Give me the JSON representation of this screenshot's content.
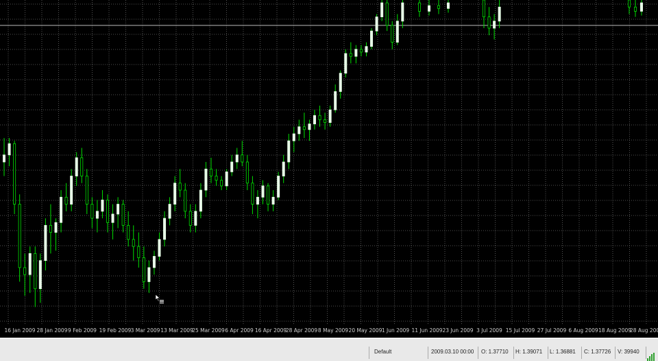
{
  "chart_data": {
    "type": "candlestick",
    "symbol_timeframe": "",
    "x_ticks": [
      "16 Jan 2009",
      "28 Jan 2009",
      "9 Feb 2009",
      "19 Feb 2009",
      "3 Mar 2009",
      "13 Mar 2009",
      "25 Mar 2009",
      "6 Apr 2009",
      "16 Apr 2009",
      "28 Apr 2009",
      "8 May 2009",
      "20 May 2009",
      "1 Jun 2009",
      "11 Jun 2009",
      "23 Jun 2009",
      "3 Jul 2009",
      "15 Jul 2009",
      "27 Jul 2009",
      "6 Aug 2009",
      "18 Aug 2009",
      "28 Aug 2009"
    ],
    "y_range": [
      1.24,
      1.47
    ],
    "horizontal_line": 1.452,
    "grid": true,
    "bull_color": "#e8ffe8",
    "bear_color": "#00e000",
    "wick_color": "#00e000",
    "background": "#000000",
    "grid_color": "#6a6a6a",
    "candles": [
      [
        1.355,
        1.372,
        1.345,
        1.36
      ],
      [
        1.36,
        1.372,
        1.352,
        1.368
      ],
      [
        1.368,
        1.37,
        1.318,
        1.325
      ],
      [
        1.325,
        1.332,
        1.27,
        1.28
      ],
      [
        1.28,
        1.29,
        1.26,
        1.275
      ],
      [
        1.275,
        1.295,
        1.262,
        1.29
      ],
      [
        1.29,
        1.295,
        1.252,
        1.265
      ],
      [
        1.265,
        1.29,
        1.255,
        1.285
      ],
      [
        1.285,
        1.315,
        1.278,
        1.31
      ],
      [
        1.31,
        1.325,
        1.29,
        1.305
      ],
      [
        1.305,
        1.315,
        1.292,
        1.312
      ],
      [
        1.312,
        1.335,
        1.305,
        1.33
      ],
      [
        1.33,
        1.34,
        1.32,
        1.325
      ],
      [
        1.325,
        1.35,
        1.32,
        1.345
      ],
      [
        1.345,
        1.362,
        1.338,
        1.358
      ],
      [
        1.358,
        1.365,
        1.34,
        1.345
      ],
      [
        1.345,
        1.35,
        1.318,
        1.325
      ],
      [
        1.325,
        1.33,
        1.308,
        1.315
      ],
      [
        1.315,
        1.328,
        1.305,
        1.32
      ],
      [
        1.32,
        1.335,
        1.315,
        1.328
      ],
      [
        1.328,
        1.332,
        1.305,
        1.312
      ],
      [
        1.312,
        1.325,
        1.3,
        1.318
      ],
      [
        1.318,
        1.33,
        1.308,
        1.325
      ],
      [
        1.325,
        1.328,
        1.305,
        1.31
      ],
      [
        1.31,
        1.32,
        1.295,
        1.3
      ],
      [
        1.3,
        1.31,
        1.285,
        1.295
      ],
      [
        1.295,
        1.305,
        1.28,
        1.287
      ],
      [
        1.287,
        1.295,
        1.265,
        1.27
      ],
      [
        1.27,
        1.285,
        1.262,
        1.28
      ],
      [
        1.28,
        1.292,
        1.275,
        1.288
      ],
      [
        1.288,
        1.305,
        1.285,
        1.3
      ],
      [
        1.3,
        1.32,
        1.295,
        1.315
      ],
      [
        1.315,
        1.33,
        1.31,
        1.325
      ],
      [
        1.325,
        1.345,
        1.32,
        1.34
      ],
      [
        1.34,
        1.35,
        1.33,
        1.335
      ],
      [
        1.335,
        1.34,
        1.315,
        1.32
      ],
      [
        1.32,
        1.325,
        1.305,
        1.31
      ],
      [
        1.31,
        1.325,
        1.305,
        1.32
      ],
      [
        1.32,
        1.34,
        1.315,
        1.335
      ],
      [
        1.335,
        1.355,
        1.33,
        1.35
      ],
      [
        1.35,
        1.358,
        1.34,
        1.345
      ],
      [
        1.345,
        1.35,
        1.338,
        1.342
      ],
      [
        1.342,
        1.345,
        1.335,
        1.338
      ],
      [
        1.338,
        1.35,
        1.335,
        1.348
      ],
      [
        1.348,
        1.36,
        1.345,
        1.355
      ],
      [
        1.355,
        1.365,
        1.35,
        1.36
      ],
      [
        1.36,
        1.37,
        1.352,
        1.355
      ],
      [
        1.355,
        1.36,
        1.335,
        1.34
      ],
      [
        1.34,
        1.345,
        1.318,
        1.325
      ],
      [
        1.325,
        1.335,
        1.315,
        1.33
      ],
      [
        1.33,
        1.342,
        1.325,
        1.338
      ],
      [
        1.338,
        1.34,
        1.32,
        1.325
      ],
      [
        1.325,
        1.335,
        1.32,
        1.33
      ],
      [
        1.33,
        1.348,
        1.328,
        1.345
      ],
      [
        1.345,
        1.36,
        1.34,
        1.355
      ],
      [
        1.355,
        1.375,
        1.35,
        1.37
      ],
      [
        1.37,
        1.38,
        1.362,
        1.375
      ],
      [
        1.375,
        1.385,
        1.37,
        1.38
      ],
      [
        1.38,
        1.39,
        1.372,
        1.378
      ],
      [
        1.378,
        1.385,
        1.37,
        1.382
      ],
      [
        1.382,
        1.392,
        1.378,
        1.388
      ],
      [
        1.388,
        1.395,
        1.38,
        1.385
      ],
      [
        1.385,
        1.39,
        1.378,
        1.383
      ],
      [
        1.383,
        1.395,
        1.38,
        1.392
      ],
      [
        1.392,
        1.41,
        1.39,
        1.405
      ],
      [
        1.405,
        1.42,
        1.4,
        1.418
      ],
      [
        1.418,
        1.435,
        1.415,
        1.432
      ],
      [
        1.432,
        1.44,
        1.425,
        1.43
      ],
      [
        1.43,
        1.438,
        1.425,
        1.435
      ],
      [
        1.435,
        1.438,
        1.43,
        1.433
      ],
      [
        1.433,
        1.44,
        1.43,
        1.437
      ],
      [
        1.437,
        1.45,
        1.435,
        1.448
      ],
      [
        1.448,
        1.46,
        1.445,
        1.458
      ],
      [
        1.458,
        1.47,
        1.455,
        1.468
      ],
      [
        1.468,
        1.47,
        1.448,
        1.452
      ],
      [
        1.452,
        1.455,
        1.435,
        1.44
      ],
      [
        1.44,
        1.46,
        1.438,
        1.455
      ],
      [
        1.455,
        1.47,
        1.45,
        1.468
      ]
    ],
    "right_cluster": [
      [
        1.468,
        1.47,
        1.458,
        1.462
      ],
      [
        1.462,
        1.47,
        1.459,
        1.466
      ],
      [
        1.466,
        1.47,
        1.46,
        1.464
      ],
      [
        1.464,
        1.47,
        1.461,
        1.468
      ]
    ],
    "right_cluster2": [
      [
        1.47,
        1.47,
        1.45,
        1.458
      ],
      [
        1.458,
        1.465,
        1.445,
        1.45
      ],
      [
        1.45,
        1.46,
        1.442,
        1.455
      ],
      [
        1.455,
        1.47,
        1.45,
        1.465
      ]
    ],
    "right_cluster3": [
      [
        1.47,
        1.47,
        1.46,
        1.465
      ],
      [
        1.465,
        1.47,
        1.458,
        1.462
      ],
      [
        1.462,
        1.47,
        1.459,
        1.468
      ]
    ]
  },
  "status_bar": {
    "profile": "Default",
    "datetime": "2009.03.10 00:00",
    "open": "O: 1.37710",
    "high": "H: 1.39071",
    "low": "L: 1.36881",
    "close": "C: 1.37726",
    "volume": "V: 39940"
  },
  "icons": {
    "cursor": "crosshair-cursor-icon",
    "connection": "connection-bars-icon"
  }
}
